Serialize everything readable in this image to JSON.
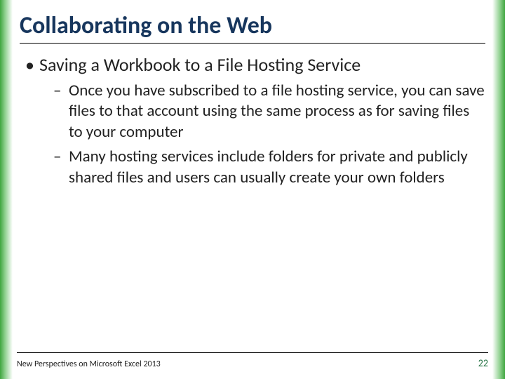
{
  "title": "Collaborating on the Web",
  "bullets": {
    "main": "Saving a Workbook to a File Hosting Service",
    "sub1": "Once you have subscribed to a file hosting service, you can save files to that account using the same process as for saving files to your computer",
    "sub2": "Many hosting services include folders for private and publicly shared files and users can usually create your own folders"
  },
  "footer": {
    "text": "New Perspectives on Microsoft Excel 2013",
    "page": "22"
  }
}
